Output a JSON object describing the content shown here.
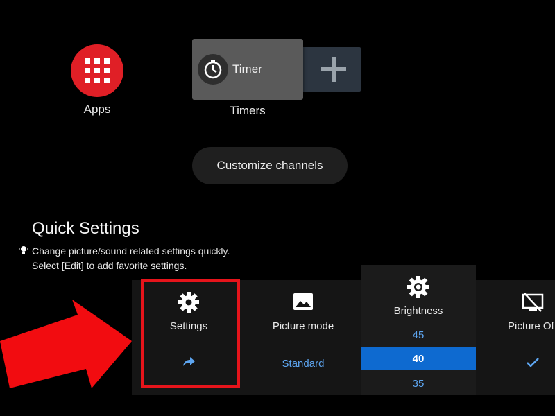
{
  "home": {
    "apps_label": "Apps",
    "timer_card_title": "Timer",
    "timers_label": "Timers",
    "customize_label": "Customize channels"
  },
  "quick_settings": {
    "title": "Quick Settings",
    "hint_line1": "Change picture/sound related settings quickly.",
    "hint_line2": "Select [Edit] to add favorite settings.",
    "tiles": {
      "settings": {
        "label": "Settings",
        "icon": "gear-icon"
      },
      "picture_mode": {
        "label": "Picture mode",
        "value": "Standard",
        "icon": "image-icon"
      },
      "brightness": {
        "label": "Brightness",
        "icon": "sun-icon",
        "options": [
          "45",
          "40",
          "35"
        ],
        "selected": "40"
      },
      "picture_off": {
        "label": "Picture Of",
        "icon": "screen-off-icon"
      }
    }
  },
  "colors": {
    "accent_blue": "#0e6ad0",
    "value_blue": "#5da5f0",
    "apps_red": "#e01f26",
    "highlight_red": "#e6141b"
  }
}
